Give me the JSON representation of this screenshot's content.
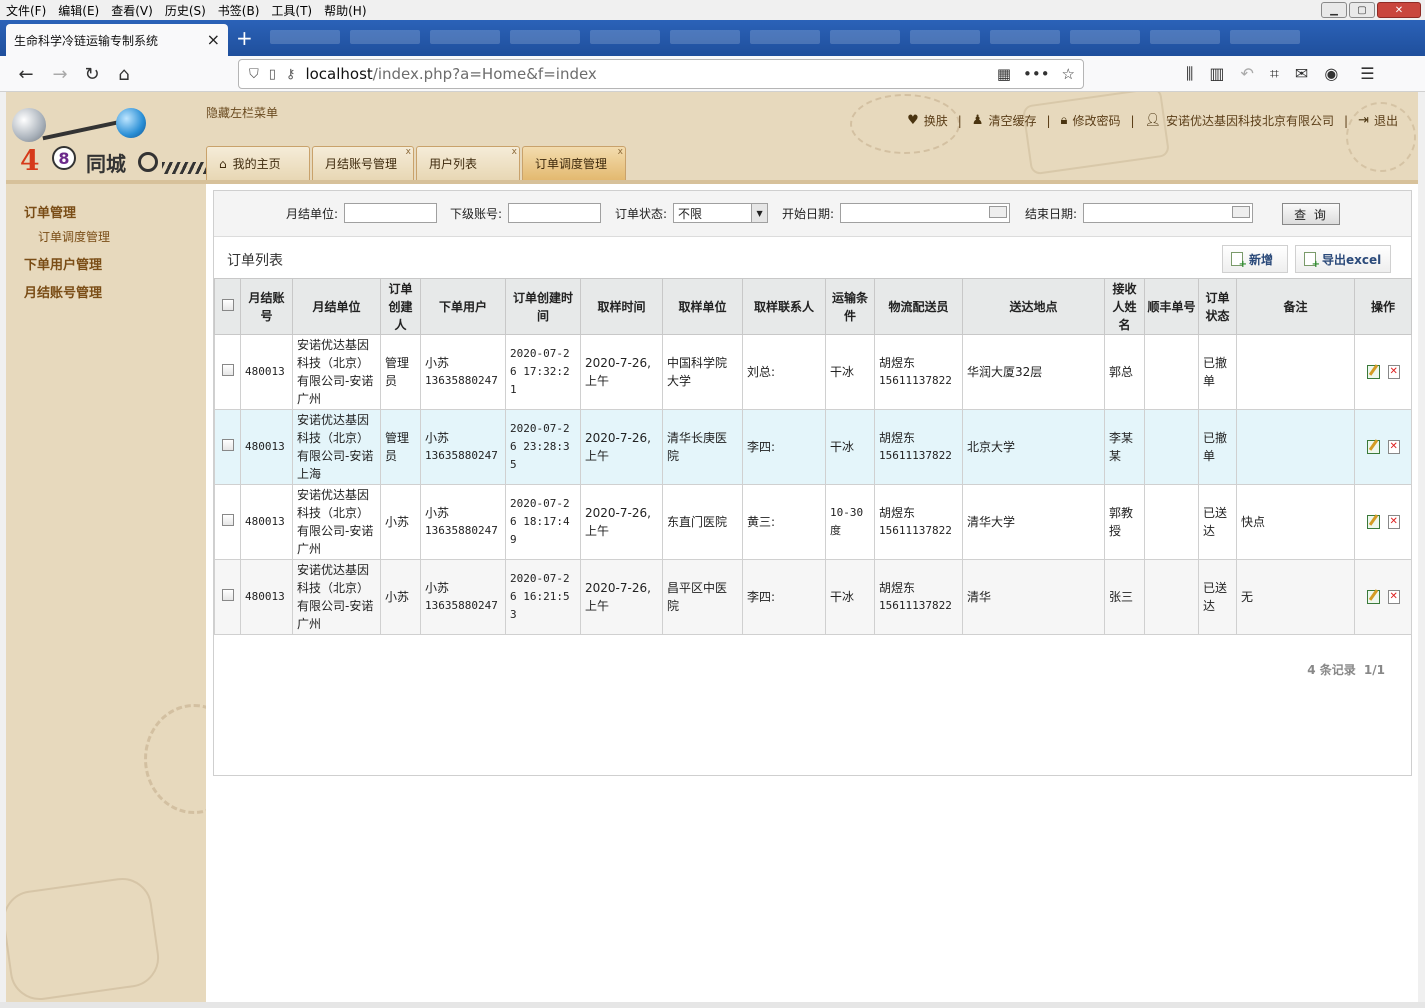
{
  "browser": {
    "menu": [
      "文件(F)",
      "编辑(E)",
      "查看(V)",
      "历史(S)",
      "书签(B)",
      "工具(T)",
      "帮助(H)"
    ],
    "tab_title": "生命科学冷链运输专制系统",
    "url_host": "localhost",
    "url_path": "/index.php?a=Home&f=index"
  },
  "header": {
    "logo_city": "同城",
    "logo_4": "4",
    "logo_8": "8",
    "hide_menu": "隐藏左栏菜单",
    "links": {
      "skin": "换肤",
      "clear_cache": "清空缓存",
      "change_password": "修改密码",
      "company": "安诺优达基因科技北京有限公司",
      "logout": "退出"
    },
    "tabs": [
      {
        "label": "我的主页",
        "close": ""
      },
      {
        "label": "月结账号管理",
        "close": "x"
      },
      {
        "label": "用户列表",
        "close": "x"
      },
      {
        "label": "订单调度管理",
        "close": "x"
      }
    ]
  },
  "sidebar": {
    "items": [
      {
        "label": "订单管理"
      },
      {
        "label": "订单调度管理"
      },
      {
        "label": "下单用户管理"
      },
      {
        "label": "月结账号管理"
      }
    ]
  },
  "search": {
    "unit_label": "月结单位:",
    "sub_account_label": "下级账号:",
    "status_label": "订单状态:",
    "status_value": "不限",
    "start_label": "开始日期:",
    "end_label": "结束日期:",
    "query_button": "查 询"
  },
  "list": {
    "title": "订单列表",
    "add_button": "新增",
    "export_button": "导出excel",
    "columns": [
      "月结账号",
      "月结单位",
      "订单创建人",
      "下单用户",
      "订单创建时间",
      "取样时间",
      "取样单位",
      "取样联系人",
      "运输条件",
      "物流配送员",
      "送达地点",
      "接收人姓名",
      "顺丰单号",
      "订单状态",
      "备注",
      "操作"
    ],
    "rows": [
      {
        "account": "480013",
        "unit": "安诺优达基因科技（北京）有限公司-安诺广州",
        "creator": "管理员",
        "user": "小苏",
        "user_phone": "13635880247",
        "created": "2020-07-26 17:32:21",
        "sample_time": "2020-7-26,上午",
        "sample_unit": "中国科学院大学",
        "contact": "刘总:",
        "transport": "干冰",
        "courier": "胡煜东",
        "courier_phone": "15611137822",
        "dest": "华润大厦32层",
        "receiver": "郭总",
        "sf_no": "",
        "status": "已撤单",
        "remark": ""
      },
      {
        "account": "480013",
        "unit": "安诺优达基因科技（北京）有限公司-安诺上海",
        "creator": "管理员",
        "user": "小苏",
        "user_phone": "13635880247",
        "created": "2020-07-26 23:28:35",
        "sample_time": "2020-7-26,上午",
        "sample_unit": "清华长庚医院",
        "contact": "李四:",
        "transport": "干冰",
        "courier": "胡煜东",
        "courier_phone": "15611137822",
        "dest": "北京大学",
        "receiver": "李某某",
        "sf_no": "",
        "status": "已撤单",
        "remark": ""
      },
      {
        "account": "480013",
        "unit": "安诺优达基因科技（北京）有限公司-安诺广州",
        "creator": "小苏",
        "user": "小苏",
        "user_phone": "13635880247",
        "created": "2020-07-26 18:17:49",
        "sample_time": "2020-7-26,上午",
        "sample_unit": "东直门医院",
        "contact": "黄三:",
        "transport": "10-30度",
        "courier": "胡煜东",
        "courier_phone": "15611137822",
        "dest": "清华大学",
        "receiver": "郭教授",
        "sf_no": "",
        "status": "已送达",
        "remark": "快点"
      },
      {
        "account": "480013",
        "unit": "安诺优达基因科技（北京）有限公司-安诺广州",
        "creator": "小苏",
        "user": "小苏",
        "user_phone": "13635880247",
        "created": "2020-07-26 16:21:53",
        "sample_time": "2020-7-26,上午",
        "sample_unit": "昌平区中医院",
        "contact": "李四:",
        "transport": "干冰",
        "courier": "胡煜东",
        "courier_phone": "15611137822",
        "dest": "清华",
        "receiver": "张三",
        "sf_no": "",
        "status": "已送达",
        "remark": "无"
      }
    ],
    "pager_count": "4 条记录",
    "pager_page": "1/1"
  }
}
